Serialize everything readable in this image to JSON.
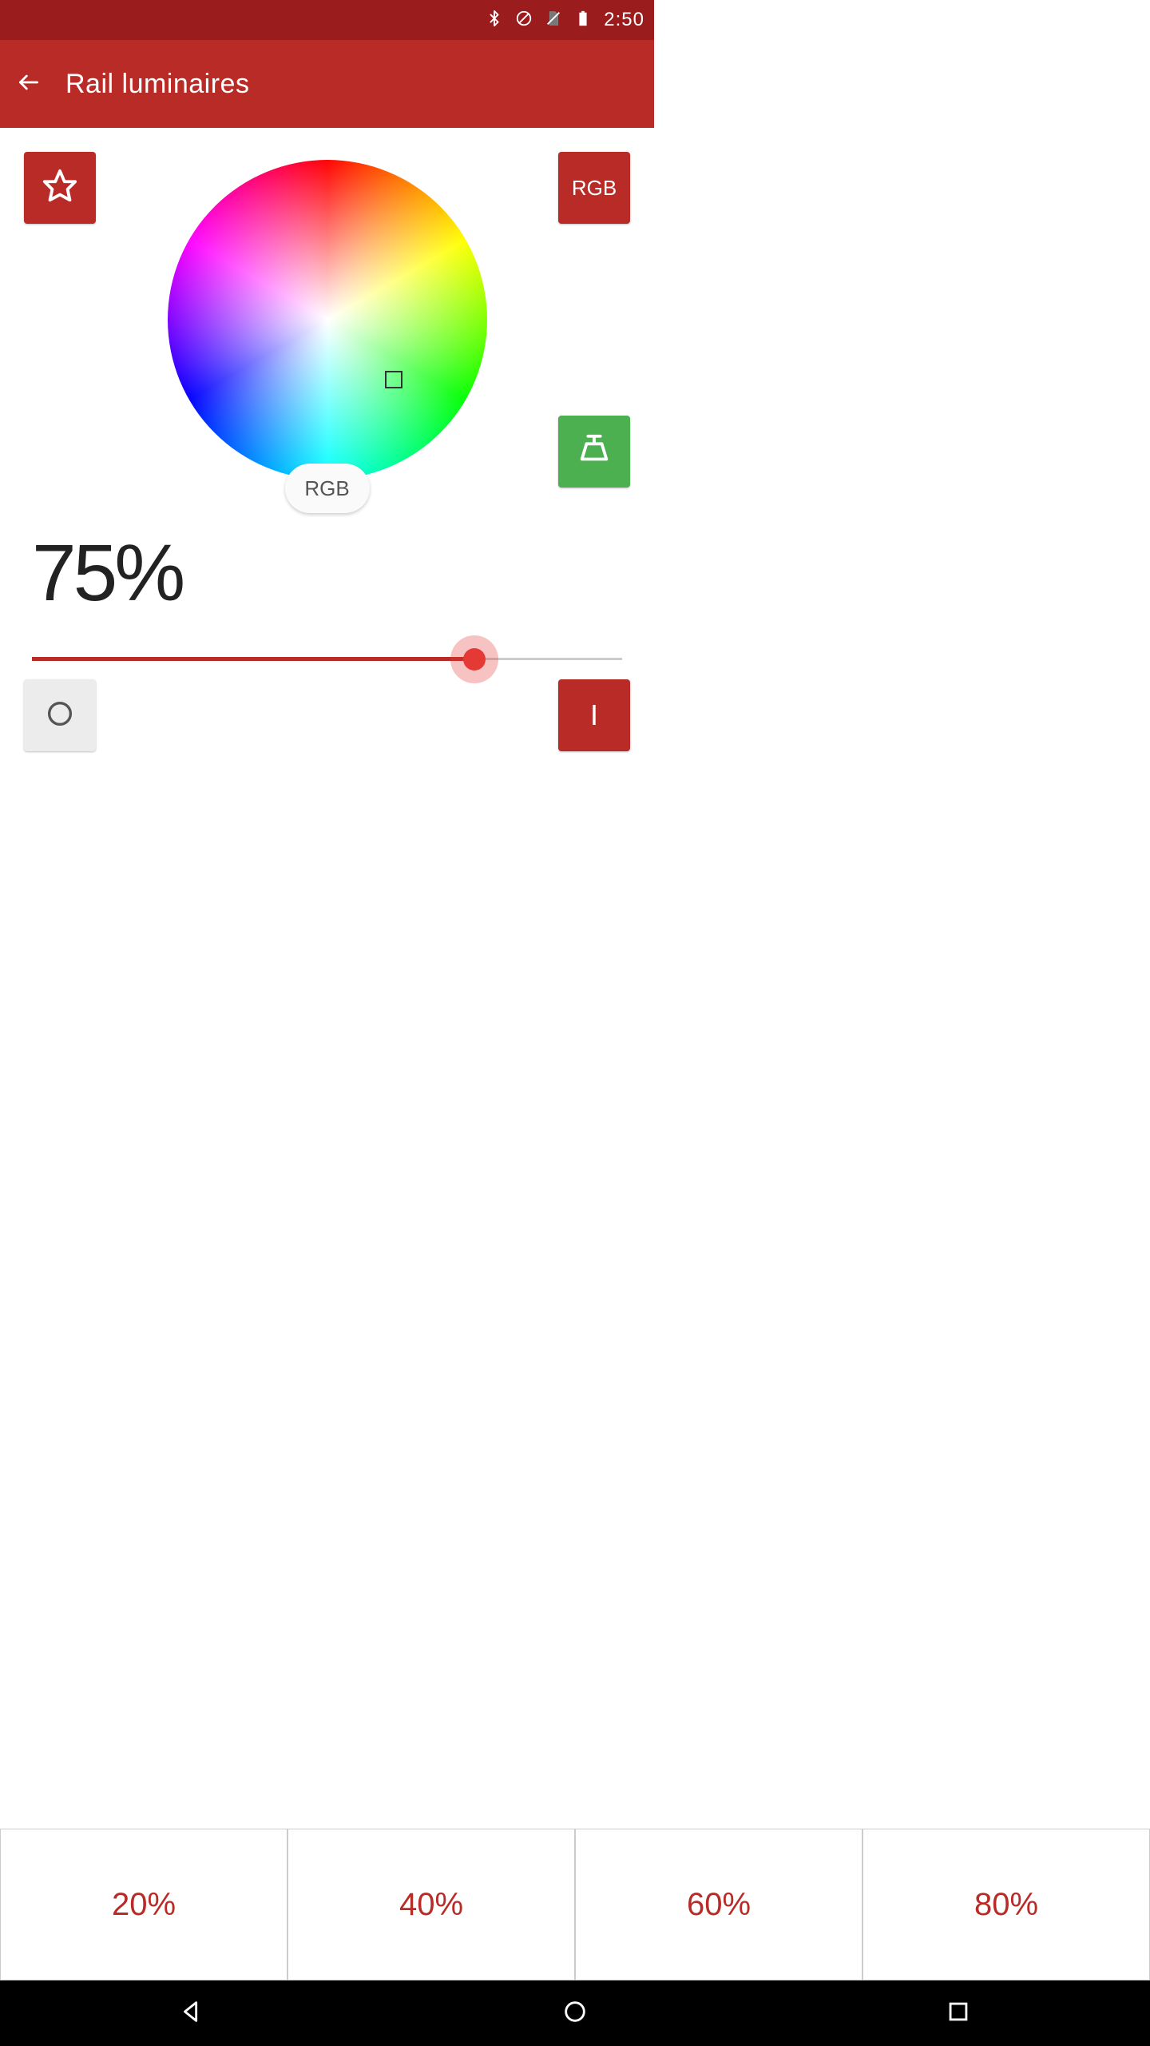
{
  "status_bar": {
    "time": "2:50",
    "icons": {
      "bluetooth": "bluetooth-icon",
      "dnd": "do-not-disturb-icon",
      "sim": "no-sim-icon",
      "battery": "battery-icon"
    }
  },
  "header": {
    "title": "Rail luminaires"
  },
  "controls": {
    "rgb_mode_label": "RGB",
    "rgb_badge_label": "RGB",
    "favorite": "star-icon",
    "lamp": "lamp-icon",
    "off": "power-off-icon",
    "on_label": "I"
  },
  "color_picker": {
    "selected_hue_indicator": "green"
  },
  "brightness": {
    "display": "75%",
    "value": 75,
    "min": 0,
    "max": 100,
    "slider_color": "#b92b27",
    "thumb_color": "#e53935"
  },
  "presets": [
    "20%",
    "40%",
    "60%",
    "80%"
  ],
  "navigation": {
    "back": "back-icon",
    "home": "home-icon",
    "recents": "recents-icon"
  },
  "colors": {
    "primary": "#b92b27",
    "status_bar": "#9b1c1c",
    "accent_green": "#4caf50"
  }
}
